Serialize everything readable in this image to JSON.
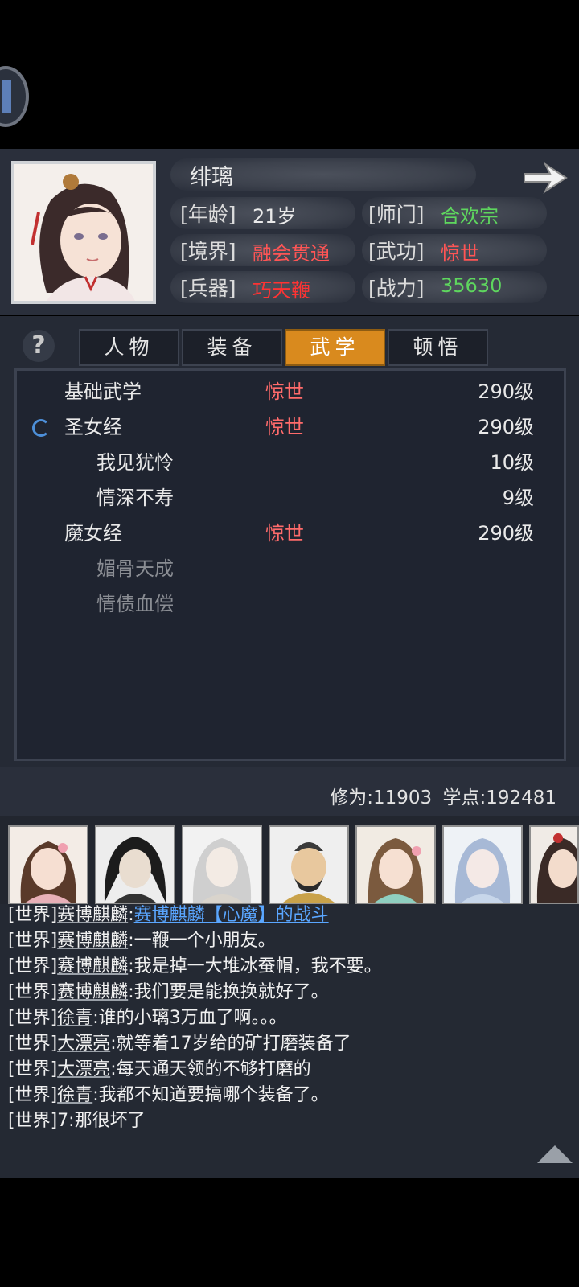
{
  "character": {
    "name": "绯璃",
    "fields": [
      {
        "label": "[年龄]",
        "value": "21岁",
        "color": "#e9e9e9"
      },
      {
        "label": "[师门]",
        "value": "合欢宗",
        "color": "#5ed65e"
      },
      {
        "label": "[境界]",
        "value": "融会贯通",
        "color": "#ff5555"
      },
      {
        "label": "[武功]",
        "value": "惊世",
        "color": "#ff5555"
      },
      {
        "label": "[兵器]",
        "value": "巧天鞭",
        "color": "#ff3333"
      },
      {
        "label": "[战力]",
        "value": "35630",
        "color": "#5ed65e"
      }
    ]
  },
  "help_icon": "?",
  "tabs": [
    {
      "label": "人物",
      "active": false
    },
    {
      "label": "装备",
      "active": false
    },
    {
      "label": "武学",
      "active": true
    },
    {
      "label": "顿悟",
      "active": false
    }
  ],
  "skills": [
    {
      "name": "基础武学",
      "tier": "惊世",
      "level": "290级",
      "indent": 0,
      "dim": false
    },
    {
      "name": "圣女经",
      "tier": "惊世",
      "level": "290级",
      "indent": 0,
      "dim": false
    },
    {
      "name": "我见犹怜",
      "tier": "",
      "level": "10级",
      "indent": 1,
      "dim": false
    },
    {
      "name": "情深不寿",
      "tier": "",
      "level": "9级",
      "indent": 1,
      "dim": false
    },
    {
      "name": "魔女经",
      "tier": "惊世",
      "level": "290级",
      "indent": 0,
      "dim": false
    },
    {
      "name": "媚骨天成",
      "tier": "",
      "level": "",
      "indent": 1,
      "dim": true
    },
    {
      "name": "情债血偿",
      "tier": "",
      "level": "",
      "indent": 1,
      "dim": true
    }
  ],
  "stats": {
    "cultivation_label": "修为:",
    "cultivation": "11903",
    "points_label": "学点:",
    "points": "192481"
  },
  "chat": [
    {
      "channel": "[世界]",
      "user": "赛博麒麟",
      "sep": ":",
      "text": "",
      "link": "赛博麒麟【心魔】的战斗"
    },
    {
      "channel": "[世界]",
      "user": "赛博麒麟",
      "sep": ":",
      "text": "一鞭一个小朋友。",
      "link": ""
    },
    {
      "channel": "[世界]",
      "user": "赛博麒麟",
      "sep": ":",
      "text": "我是掉一大堆冰蚕帽，我不要。",
      "link": ""
    },
    {
      "channel": "[世界]",
      "user": "赛博麒麟",
      "sep": ":",
      "text": "我们要是能换换就好了。",
      "link": ""
    },
    {
      "channel": "[世界]",
      "user": "徐青",
      "sep": ":",
      "text": "谁的小璃3万血了啊。。。",
      "link": ""
    },
    {
      "channel": "[世界]",
      "user": "大漂亮",
      "sep": ":",
      "text": "就等着17岁给的矿打磨装备了",
      "link": ""
    },
    {
      "channel": "[世界]",
      "user": "大漂亮",
      "sep": ":",
      "text": "每天通天领的不够打磨的",
      "link": ""
    },
    {
      "channel": "[世界]",
      "user": "徐青",
      "sep": ":",
      "text": "我都不知道要搞哪个装备了。",
      "link": ""
    },
    {
      "channel": "[世界]",
      "user": "7",
      "sep": ":",
      "text": "那很坏了",
      "link": ""
    }
  ]
}
